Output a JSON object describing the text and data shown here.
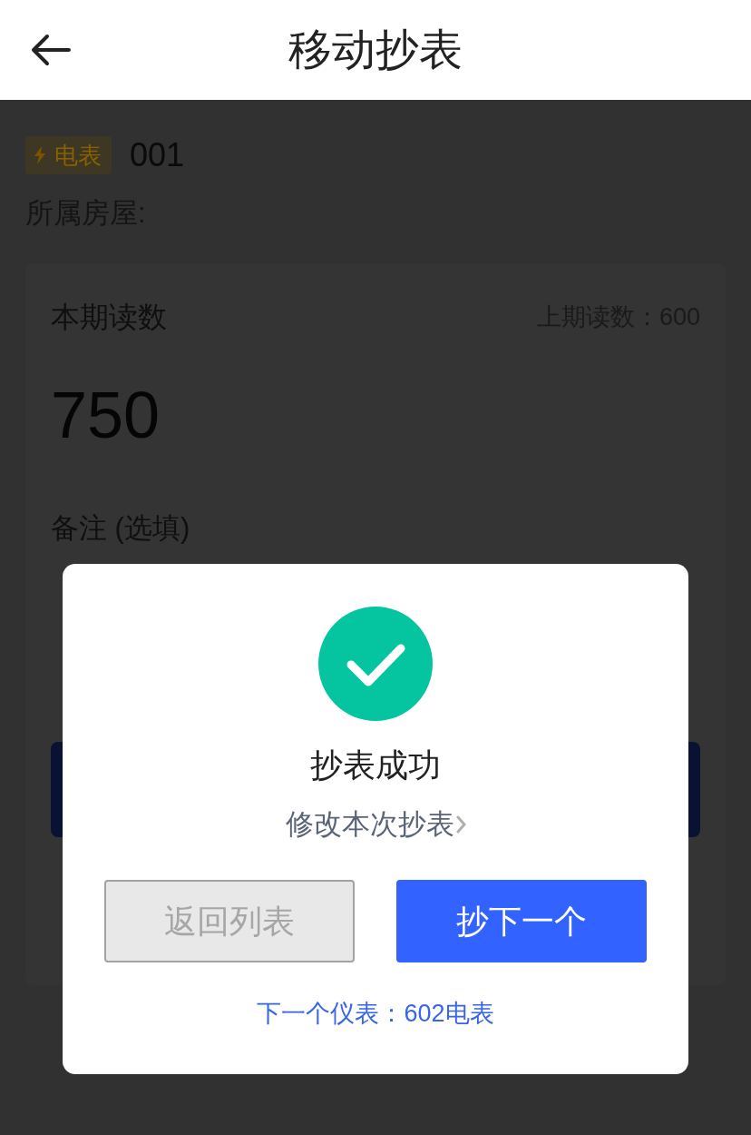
{
  "header": {
    "title": "移动抄表"
  },
  "meter": {
    "type_badge": "电表",
    "number": "001",
    "house_label": "所属房屋:"
  },
  "reading_card": {
    "current_label": "本期读数",
    "previous": "上期读数：600",
    "current_value": "750",
    "note_label": "备注 (选填)"
  },
  "dialog": {
    "title": "抄表成功",
    "edit_link": "修改本次抄表",
    "buttons": [
      {
        "label": "返回列表",
        "kind": "secondary"
      },
      {
        "label": "抄下一个",
        "kind": "primary"
      }
    ],
    "next_meter": "下一个仪表：602电表"
  }
}
